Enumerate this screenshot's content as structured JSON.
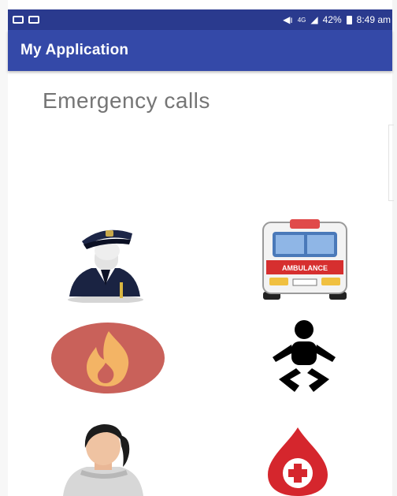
{
  "status_bar": {
    "time": "8:49 am",
    "battery": "42%",
    "network": "4G"
  },
  "app_bar": {
    "title": "My Application"
  },
  "main": {
    "heading": "Emergency calls",
    "tiles": [
      {
        "icon": "police-officer-icon"
      },
      {
        "icon": "ambulance-icon",
        "vehicle_text": "AMBULANCE"
      },
      {
        "icon": "fire-icon"
      },
      {
        "icon": "baby-icon"
      },
      {
        "icon": "woman-icon"
      },
      {
        "icon": "blood-drop-icon"
      }
    ]
  },
  "colors": {
    "status_bar": "#2a3a8e",
    "app_bar": "#3449a8",
    "heading_text": "#757575",
    "fire_circle": "#c9615a",
    "fire_flame": "#f3b465",
    "blood_red": "#d5262d"
  }
}
